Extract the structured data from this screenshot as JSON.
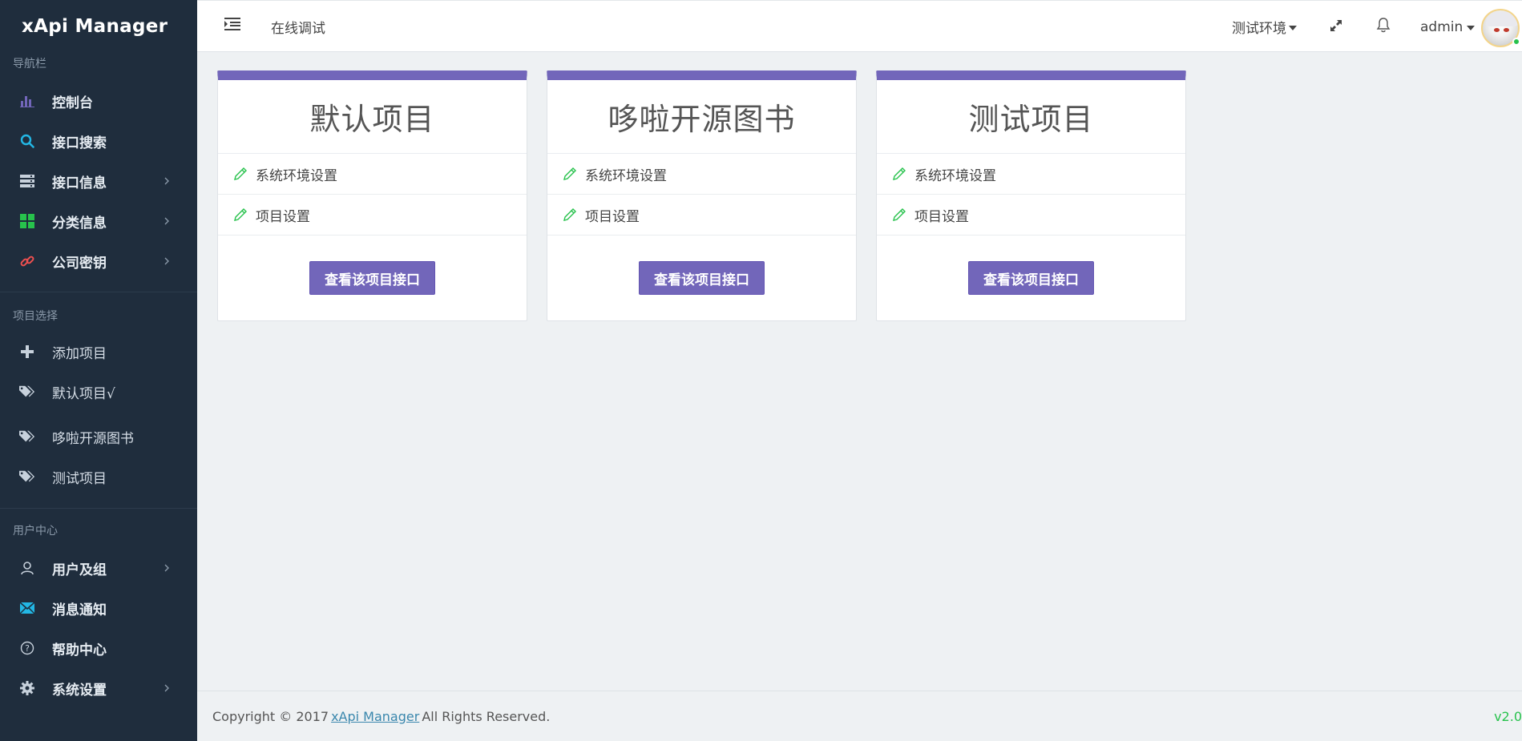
{
  "app": {
    "brand": "xApi Manager"
  },
  "sidebar": {
    "sections": [
      {
        "title": "导航栏",
        "items": [
          {
            "label": "控制台",
            "icon": "bar-chart-icon",
            "color": "#7266ba",
            "has_submenu": false
          },
          {
            "label": "接口搜索",
            "icon": "search-icon",
            "color": "#23b7e5",
            "has_submenu": false
          },
          {
            "label": "接口信息",
            "icon": "server-icon",
            "color": "#c7d1dc",
            "has_submenu": true
          },
          {
            "label": "分类信息",
            "icon": "grid-icon",
            "color": "#27c24c",
            "has_submenu": true
          },
          {
            "label": "公司密钥",
            "icon": "link-icon",
            "color": "#f05050",
            "has_submenu": true
          }
        ]
      },
      {
        "title": "项目选择",
        "items": [
          {
            "label": "添加项目",
            "icon": "plus-icon"
          },
          {
            "label": "默认项目√",
            "icon": "tags-icon"
          },
          {
            "label": "哆啦开源图书",
            "icon": "tags-icon"
          },
          {
            "label": "测试项目",
            "icon": "tags-icon"
          }
        ]
      },
      {
        "title": "用户中心",
        "items": [
          {
            "label": "用户及组",
            "icon": "user-icon",
            "has_submenu": true
          },
          {
            "label": "消息通知",
            "icon": "envelope-icon",
            "color": "#23b7e5",
            "has_submenu": false
          },
          {
            "label": "帮助中心",
            "icon": "help-icon",
            "has_submenu": false
          },
          {
            "label": "系统设置",
            "icon": "gear-icon",
            "has_submenu": true
          }
        ]
      }
    ]
  },
  "header": {
    "title": "在线调试",
    "environment": "测试环境",
    "user": "admin"
  },
  "projects": [
    {
      "name": "默认项目",
      "env_setting": "系统环境设置",
      "project_setting": "项目设置",
      "button": "查看该项目接口"
    },
    {
      "name": "哆啦开源图书",
      "env_setting": "系统环境设置",
      "project_setting": "项目设置",
      "button": "查看该项目接口"
    },
    {
      "name": "测试项目",
      "env_setting": "系统环境设置",
      "project_setting": "项目设置",
      "button": "查看该项目接口"
    }
  ],
  "footer": {
    "copyright_prefix": "Copyright © 2017",
    "link_text": "xApi Manager",
    "copyright_suffix": "All Rights Reserved.",
    "version": "v2.0"
  },
  "colors": {
    "accent": "#7266ba",
    "sidebar_bg": "#1f2d3d",
    "success": "#27c24c"
  }
}
